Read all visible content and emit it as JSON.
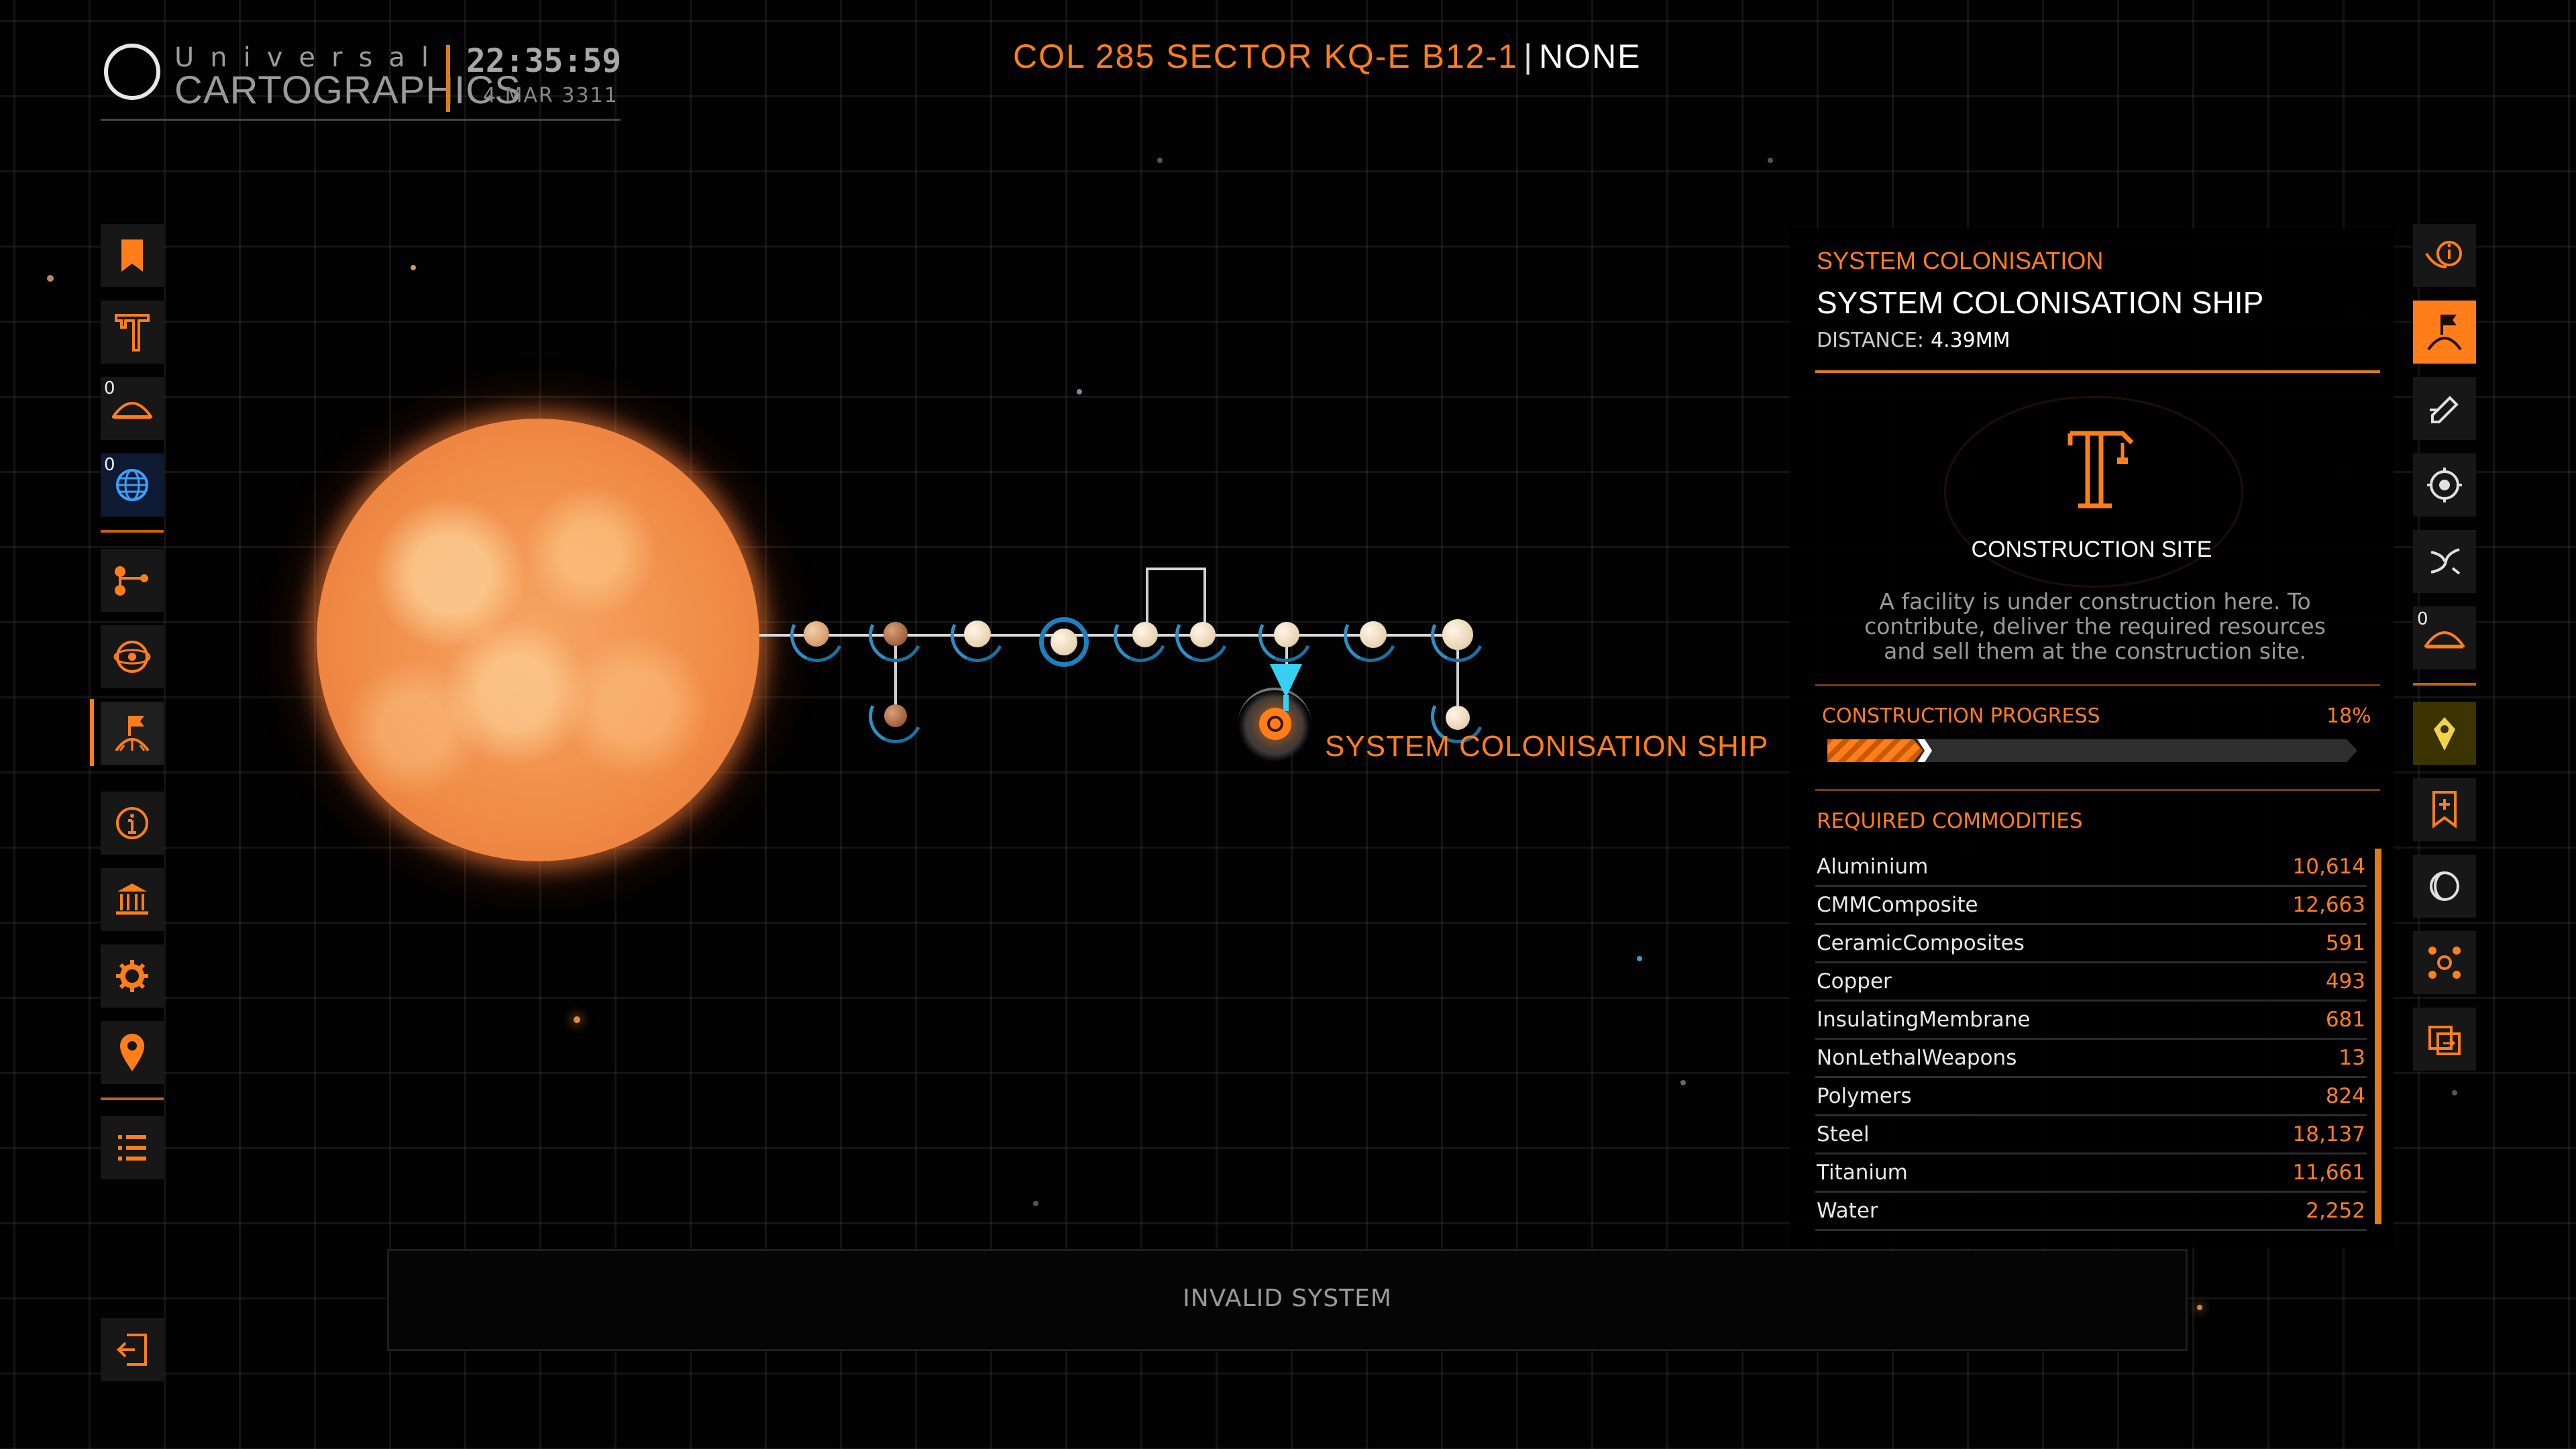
{
  "header": {
    "logo_top": "Universal",
    "logo_main": "CARTOGRAPHICS",
    "time": "22:35:59",
    "date": "4 MAR 3311",
    "system_name": "COL 285 SECTOR KQ-E B12-1",
    "system_state": "NONE"
  },
  "left_nav": {
    "items": [
      {
        "name": "bookmarks",
        "icon": "bookmark-icon"
      },
      {
        "name": "construction",
        "icon": "crane-icon"
      },
      {
        "name": "landable",
        "icon": "terrain-icon",
        "count": "0"
      },
      {
        "name": "earthlike",
        "icon": "globe-icon",
        "count": "0"
      },
      {
        "name": "route",
        "icon": "route-icon"
      },
      {
        "name": "galaxy",
        "icon": "orbit-icon"
      },
      {
        "name": "colonisation",
        "icon": "flag-icon"
      },
      {
        "name": "info",
        "icon": "info-icon"
      },
      {
        "name": "government",
        "icon": "bank-icon"
      },
      {
        "name": "settings",
        "icon": "gear-icon"
      },
      {
        "name": "location",
        "icon": "pin-icon"
      },
      {
        "name": "list",
        "icon": "list-icon"
      },
      {
        "name": "exit",
        "icon": "exit-icon"
      }
    ]
  },
  "right_nav": {
    "items": [
      {
        "name": "info",
        "icon": "info-hand-icon"
      },
      {
        "name": "colonisation",
        "icon": "flag-icon"
      },
      {
        "name": "edit",
        "icon": "edit-icon"
      },
      {
        "name": "target",
        "icon": "target-icon"
      },
      {
        "name": "swap",
        "icon": "swap-icon"
      },
      {
        "name": "landable",
        "icon": "terrain-icon",
        "count": "0"
      },
      {
        "name": "marker",
        "icon": "marker-icon"
      },
      {
        "name": "bookmark",
        "icon": "bookmark-icon"
      },
      {
        "name": "planet",
        "icon": "crescent-icon"
      },
      {
        "name": "network",
        "icon": "network-icon"
      },
      {
        "name": "export",
        "icon": "export-icon"
      }
    ]
  },
  "map": {
    "selected_label": "SYSTEM COLONISATION SHIP"
  },
  "panel": {
    "category": "SYSTEM COLONISATION",
    "title": "SYSTEM COLONISATION SHIP",
    "distance_label": "DISTANCE:",
    "distance_value": "4.39MM",
    "site_title": "CONSTRUCTION SITE",
    "description": "A facility is under construction here. To contribute, deliver the required resources and sell them at the construction site.",
    "progress_label": "CONSTRUCTION PROGRESS",
    "progress_text": "18%",
    "progress_fraction": 0.18,
    "required_label": "REQUIRED COMMODITIES",
    "commodities": [
      {
        "name": "Aluminium",
        "amount": "10,614"
      },
      {
        "name": "CMMComposite",
        "amount": "12,663"
      },
      {
        "name": "CeramicComposites",
        "amount": "591"
      },
      {
        "name": "Copper",
        "amount": "493"
      },
      {
        "name": "InsulatingMembrane",
        "amount": "681"
      },
      {
        "name": "NonLethalWeapons",
        "amount": "13"
      },
      {
        "name": "Polymers",
        "amount": "824"
      },
      {
        "name": "Steel",
        "amount": "18,137"
      },
      {
        "name": "Titanium",
        "amount": "11,661"
      },
      {
        "name": "Water",
        "amount": "2,252"
      }
    ]
  },
  "status": {
    "text": "INVALID SYSTEM"
  },
  "colors": {
    "accent": "#ff7e1a",
    "marker": "#38d0f0"
  }
}
